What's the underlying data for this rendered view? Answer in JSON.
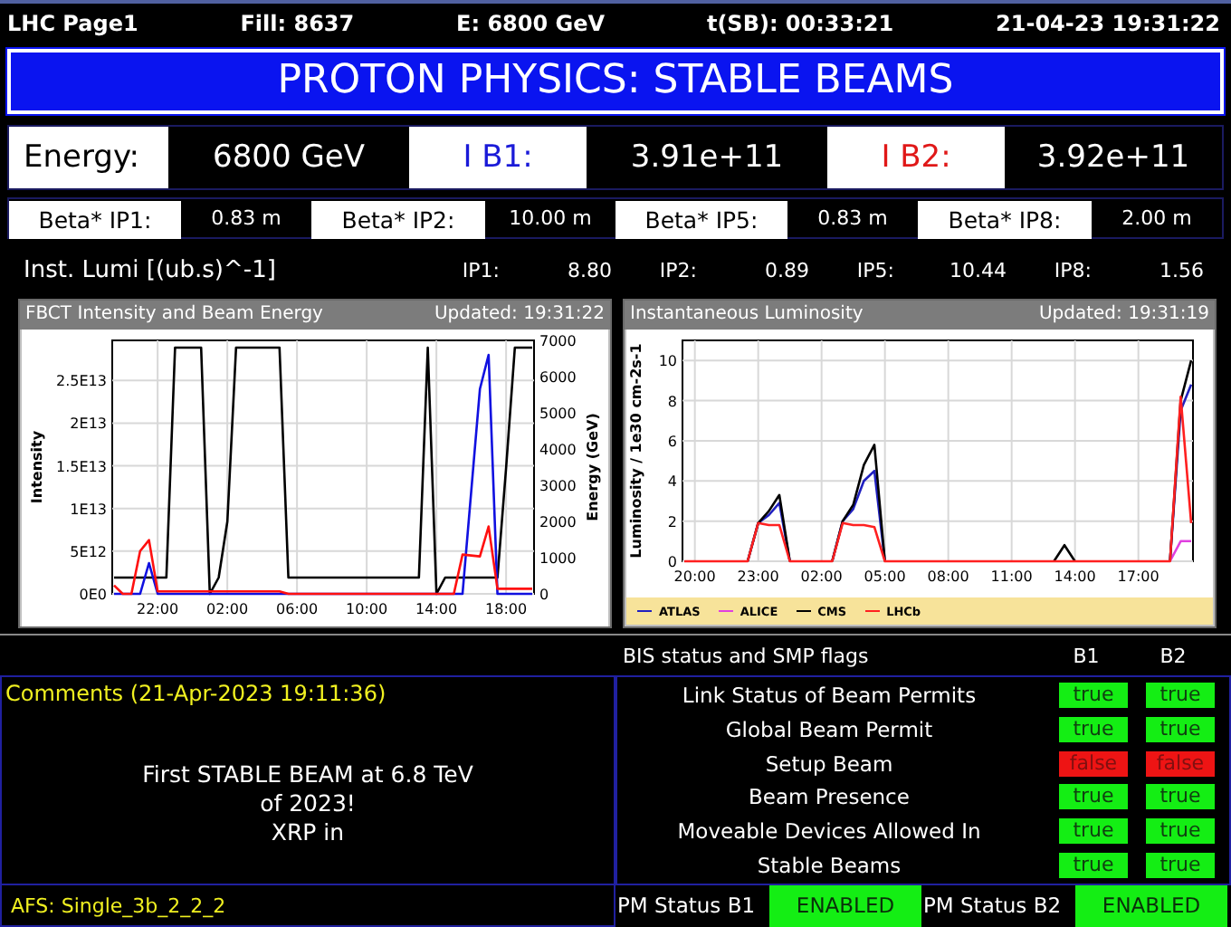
{
  "header_items": [
    "LHC Page1",
    "Fill: 8637",
    "E:  6800 GeV",
    "t(SB): 00:33:21",
    "21-04-23 19:31:22"
  ],
  "mode_banner": "PROTON PHYSICS: STABLE BEAMS",
  "beam_row": [
    {
      "label": "Energy:",
      "value": "6800 GeV",
      "color": "#000000"
    },
    {
      "label": "I B1:",
      "value": "3.91e+11",
      "color": "#1a1ad8"
    },
    {
      "label": "I B2:",
      "value": "3.92e+11",
      "color": "#e01818"
    }
  ],
  "beta_star": [
    {
      "label": "Beta* IP1:",
      "value": "0.83 m"
    },
    {
      "label": "Beta* IP2:",
      "value": "10.00 m"
    },
    {
      "label": "Beta* IP5:",
      "value": "0.83 m"
    },
    {
      "label": "Beta* IP8:",
      "value": "2.00 m"
    }
  ],
  "lumi": {
    "label": "Inst. Lumi [(ub.s)^-1]",
    "items": [
      {
        "label": "IP1:",
        "value": "8.80"
      },
      {
        "label": "IP2:",
        "value": "0.89"
      },
      {
        "label": "IP5:",
        "value": "10.44"
      },
      {
        "label": "IP8:",
        "value": "1.56"
      }
    ]
  },
  "charts": [
    {
      "title": "FBCT Intensity and Beam Energy",
      "updated": "Updated: 19:31:22",
      "chart_data": {
        "type": "line",
        "grid": true,
        "ylabel": "Intensity",
        "y2label": "Energy (GeV)",
        "ylim": [
          0,
          29700000000000.0
        ],
        "y2lim": [
          0,
          7000
        ],
        "categories": [
          null,
          null,
          null,
          null,
          null,
          "22:00",
          null,
          null,
          null,
          null,
          null,
          null,
          null,
          "02:00",
          null,
          null,
          null,
          null,
          null,
          null,
          null,
          "06:00",
          null,
          null,
          null,
          null,
          null,
          null,
          null,
          "10:00",
          null,
          null,
          null,
          null,
          null,
          null,
          null,
          "14:00",
          null,
          null,
          null,
          null,
          null,
          null,
          null,
          "18:00",
          null,
          null,
          null
        ],
        "yticks": [
          {
            "value": 0,
            "label": "0E0"
          },
          {
            "value": 5000000000000.0,
            "label": "5E12"
          },
          {
            "value": 10000000000000.0,
            "label": "1E13"
          },
          {
            "value": 15000000000000.0,
            "label": "1.5E13"
          },
          {
            "value": 20000000000000.0,
            "label": "2E13"
          },
          {
            "value": 25000000000000.0,
            "label": "2.5E13"
          }
        ],
        "y2ticks": [
          0,
          1000,
          2000,
          3000,
          4000,
          5000,
          6000,
          7000
        ],
        "series": [
          {
            "color": "#000000",
            "axis": "y2",
            "values": [
              450,
              450,
              450,
              450,
              450,
              450,
              450,
              6800,
              6800,
              6800,
              6800,
              0,
              450,
              2000,
              6800,
              6800,
              6800,
              6800,
              6800,
              6800,
              450,
              450,
              450,
              450,
              450,
              450,
              450,
              450,
              450,
              450,
              450,
              450,
              450,
              450,
              450,
              450,
              6800,
              0,
              450,
              450,
              450,
              450,
              450,
              450,
              450,
              3500,
              6800,
              6800,
              6800
            ]
          },
          {
            "color": "#1010e0",
            "values": [
              0,
              0,
              0,
              0,
              3600000000000.0,
              0,
              0,
              0,
              0,
              0,
              0,
              0,
              0,
              0,
              0,
              0,
              0,
              0,
              0,
              0,
              0,
              0,
              0,
              0,
              0,
              0,
              0,
              0,
              0,
              0,
              0,
              0,
              0,
              0,
              0,
              0,
              0,
              0,
              0,
              0,
              0,
              12000000000000.0,
              24000000000000.0,
              28000000000000.0,
              0,
              0,
              0,
              0,
              0
            ]
          },
          {
            "color": "#ff1010",
            "values": [
              1000000000000.0,
              0,
              0,
              5000000000000.0,
              6300000000000.0,
              300000000000.0,
              300000000000.0,
              300000000000.0,
              300000000000.0,
              300000000000.0,
              300000000000.0,
              300000000000.0,
              300000000000.0,
              300000000000.0,
              300000000000.0,
              300000000000.0,
              300000000000.0,
              300000000000.0,
              300000000000.0,
              300000000000.0,
              0,
              0,
              0,
              0,
              0,
              0,
              0,
              0,
              0,
              0,
              0,
              0,
              0,
              0,
              0,
              0,
              0,
              0,
              0,
              0,
              4600000000000.0,
              4500000000000.0,
              4400000000000.0,
              7900000000000.0,
              600000000000.0,
              600000000000.0,
              600000000000.0,
              600000000000.0,
              600000000000.0
            ]
          }
        ]
      }
    },
    {
      "title": "Instantaneous Luminosity",
      "updated": "Updated: 19:31:19",
      "chart_data": {
        "type": "line",
        "grid": true,
        "ylabel": "Luminosity / 1e30 cm-2s-1",
        "ylim": [
          0,
          11
        ],
        "categories": [
          null,
          "20:00",
          null,
          null,
          null,
          null,
          null,
          "23:00",
          null,
          null,
          null,
          null,
          null,
          "02:00",
          null,
          null,
          null,
          null,
          null,
          "05:00",
          null,
          null,
          null,
          null,
          null,
          "08:00",
          null,
          null,
          null,
          null,
          null,
          "11:00",
          null,
          null,
          null,
          null,
          null,
          "14:00",
          null,
          null,
          null,
          null,
          null,
          "17:00",
          null,
          null,
          null,
          null,
          null
        ],
        "yticks": [
          0,
          2,
          4,
          6,
          8,
          10
        ],
        "series": [
          {
            "name": "ATLAS",
            "color": "#2020c0",
            "values": [
              null,
              null,
              null,
              null,
              null,
              null,
              0,
              1.9,
              2.3,
              2.9,
              0,
              null,
              null,
              null,
              0,
              2.0,
              2.6,
              4.0,
              4.5,
              0,
              null,
              null,
              null,
              null,
              null,
              null,
              null,
              null,
              null,
              null,
              null,
              null,
              null,
              null,
              null,
              null,
              null,
              null,
              null,
              null,
              null,
              null,
              null,
              null,
              null,
              null,
              0,
              7.5,
              8.8
            ]
          },
          {
            "name": "ALICE",
            "color": "#e040e0",
            "values": [
              null,
              null,
              null,
              null,
              null,
              null,
              null,
              null,
              null,
              null,
              null,
              null,
              null,
              null,
              null,
              null,
              null,
              null,
              null,
              null,
              null,
              null,
              null,
              null,
              null,
              null,
              null,
              null,
              null,
              null,
              null,
              null,
              null,
              null,
              null,
              null,
              null,
              null,
              null,
              null,
              null,
              null,
              null,
              null,
              null,
              null,
              0,
              1.0,
              1.0
            ]
          },
          {
            "name": "CMS",
            "color": "#000000",
            "values": [
              null,
              null,
              null,
              null,
              null,
              null,
              0,
              1.9,
              2.5,
              3.3,
              0,
              null,
              null,
              null,
              0,
              2.0,
              2.8,
              4.8,
              5.8,
              0,
              null,
              null,
              null,
              null,
              null,
              null,
              null,
              null,
              null,
              null,
              null,
              null,
              null,
              null,
              null,
              0,
              0.8,
              0,
              null,
              null,
              null,
              null,
              null,
              null,
              null,
              null,
              0,
              8.0,
              10.0
            ]
          },
          {
            "name": "LHCb",
            "color": "#ff2020",
            "values": [
              0,
              0,
              0,
              0,
              0,
              0,
              0,
              1.9,
              1.8,
              1.8,
              0,
              0,
              0,
              0,
              0,
              1.9,
              1.8,
              1.8,
              1.7,
              0,
              0,
              0,
              0,
              0,
              0,
              0,
              0,
              0,
              0,
              0,
              0,
              0,
              0,
              0,
              0,
              0,
              0,
              0,
              0,
              0,
              0,
              0,
              0,
              0,
              0,
              0,
              0,
              8.2,
              1.9
            ]
          }
        ]
      }
    }
  ],
  "bis": {
    "title": "BIS status and SMP flags",
    "columns": [
      "B1",
      "B2"
    ],
    "flags": [
      {
        "label": "Link Status of Beam Permits",
        "values": [
          {
            "text": "true",
            "on": true
          },
          {
            "text": "true",
            "on": true
          }
        ]
      },
      {
        "label": "Global Beam Permit",
        "values": [
          {
            "text": "true",
            "on": true
          },
          {
            "text": "true",
            "on": true
          }
        ]
      },
      {
        "label": "Setup Beam",
        "values": [
          {
            "text": "false",
            "on": false
          },
          {
            "text": "false",
            "on": false
          }
        ]
      },
      {
        "label": "Beam Presence",
        "values": [
          {
            "text": "true",
            "on": true
          },
          {
            "text": "true",
            "on": true
          }
        ]
      },
      {
        "label": "Moveable Devices Allowed In",
        "values": [
          {
            "text": "true",
            "on": true
          },
          {
            "text": "true",
            "on": true
          }
        ]
      },
      {
        "label": "Stable Beams",
        "values": [
          {
            "text": "true",
            "on": true
          },
          {
            "text": "true",
            "on": true
          }
        ]
      }
    ]
  },
  "comments": {
    "title": "Comments (21-Apr-2023 19:11:36)",
    "text": "First STABLE BEAM at 6.8 TeV\nof 2023!\nXRP in"
  },
  "status_bar": {
    "afs": "AFS: Single_3b_2_2_2",
    "pm": [
      {
        "label": "PM Status B1",
        "value": "ENABLED",
        "enabled": true
      },
      {
        "label": "PM Status B2",
        "value": "ENABLED",
        "enabled": true
      }
    ]
  }
}
